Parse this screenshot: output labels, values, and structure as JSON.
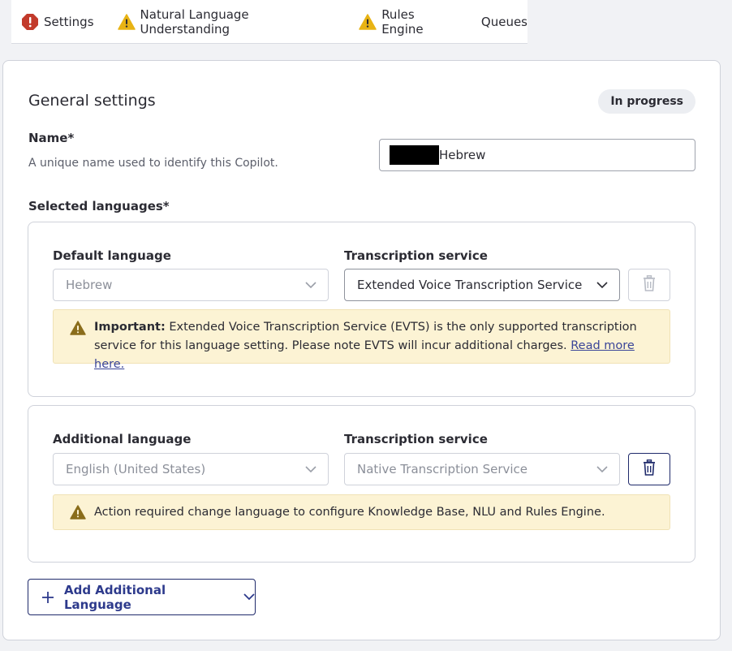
{
  "tabs": [
    {
      "label": "Settings",
      "icon": "error-octagon-icon"
    },
    {
      "label": "Natural Language Understanding",
      "icon": "warning-icon"
    },
    {
      "label": "Rules Engine",
      "icon": "warning-icon"
    },
    {
      "label": "Queues",
      "icon": ""
    }
  ],
  "section": {
    "title": "General settings",
    "status": "In progress"
  },
  "name_field": {
    "label": "Name*",
    "help": "A unique name used to identify this Copilot.",
    "value_suffix": "Hebrew"
  },
  "languages": {
    "label": "Selected languages*",
    "default": {
      "language_label": "Default language",
      "language_value": "Hebrew",
      "transcription_label": "Transcription service",
      "transcription_value": "Extended Voice Transcription Service",
      "alert_strong": "Important:",
      "alert_text": " Extended Voice Transcription Service (EVTS) is the only supported transcription service for this language setting. Please note EVTS will incur additional charges. ",
      "alert_link": "Read more here."
    },
    "additional": {
      "language_label": "Additional language",
      "language_value": "English (United States)",
      "transcription_label": "Transcription service",
      "transcription_value": "Native Transcription Service",
      "alert_text": "Action required change language to configure Knowledge Base, NLU and Rules Engine."
    },
    "add_button": "Add Additional Language"
  },
  "colors": {
    "accent": "#2d3a8c",
    "error": "#c23a2b",
    "warning": "#e8b314",
    "alert_bg": "#fcf3d4"
  }
}
